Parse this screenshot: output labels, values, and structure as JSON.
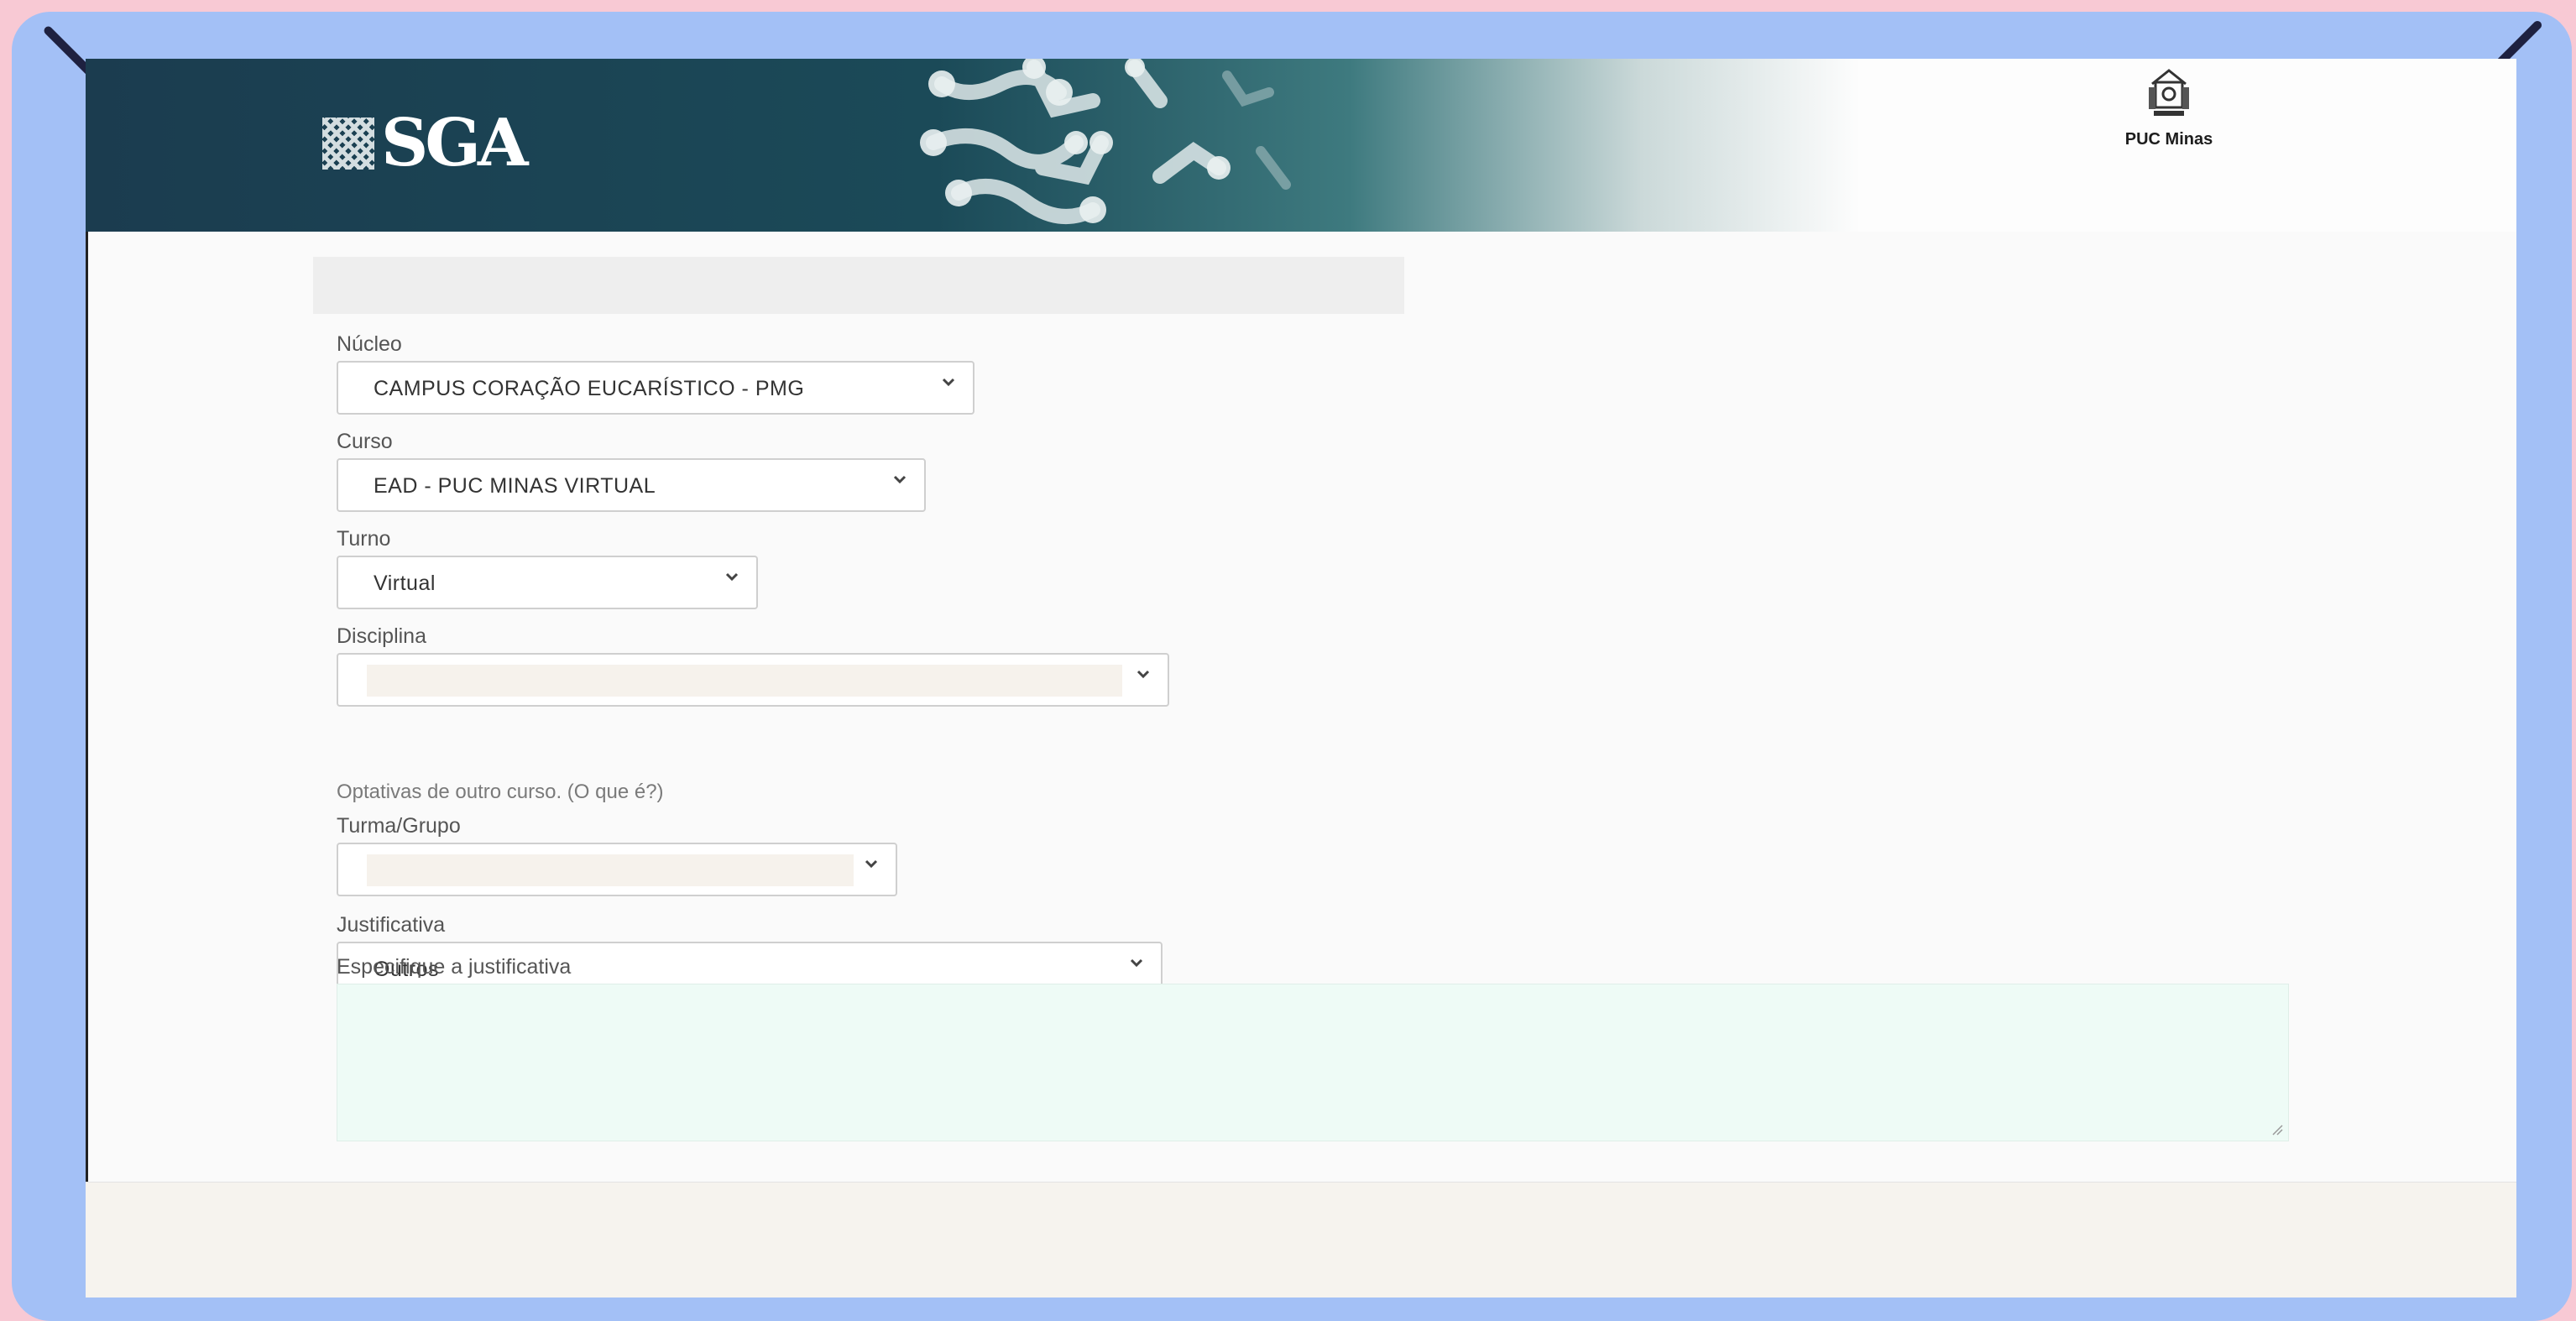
{
  "header": {
    "logo_text": "SGA",
    "institution": "PUC Minas"
  },
  "form": {
    "nucleo": {
      "label": "Núcleo",
      "value": "CAMPUS CORAÇÃO EUCARÍSTICO - PMG"
    },
    "curso": {
      "label": "Curso",
      "value": "EAD - PUC MINAS VIRTUAL"
    },
    "turno": {
      "label": "Turno",
      "value": "Virtual"
    },
    "disciplina": {
      "label": "Disciplina",
      "value": ""
    },
    "optativas_text": "Optativas de outro curso. (O que é?)",
    "turma": {
      "label": "Turma/Grupo",
      "value": ""
    },
    "justificativa": {
      "label": "Justificativa",
      "value": "Outros"
    },
    "especifique": {
      "label": "Especifique a justificativa",
      "value": ""
    }
  },
  "colors": {
    "header_dark": "#1b3c4f",
    "frame": "#a3c0f6",
    "background": "#f8c9d4",
    "textarea": "#eefbf6"
  },
  "icons": [
    "chevron-down-icon",
    "resize-grip-icon",
    "puc-crest-icon",
    "molecule-pattern"
  ]
}
